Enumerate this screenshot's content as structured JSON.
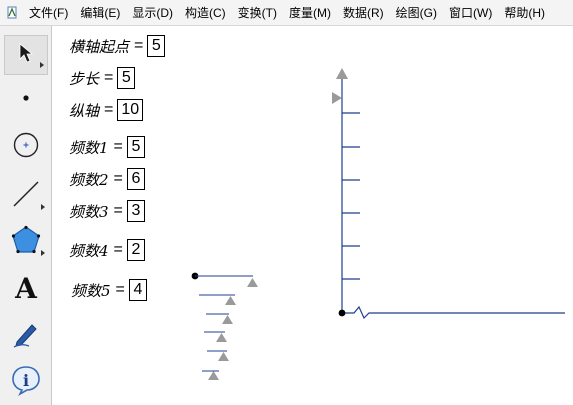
{
  "menubar": {
    "items": [
      "文件(F)",
      "编辑(E)",
      "显示(D)",
      "构造(C)",
      "变换(T)",
      "度量(M)",
      "数据(R)",
      "绘图(G)",
      "窗口(W)",
      "帮助(H)"
    ]
  },
  "toolbar": {
    "tools": [
      {
        "name": "arrow-select-tool",
        "icon": "arrow-icon"
      },
      {
        "name": "point-tool",
        "icon": "point-icon"
      },
      {
        "name": "compass-tool",
        "icon": "circle-icon"
      },
      {
        "name": "straightedge-tool",
        "icon": "line-icon"
      },
      {
        "name": "polygon-tool",
        "icon": "pentagon-icon"
      },
      {
        "name": "text-tool",
        "icon": "text-A-icon",
        "glyph": "A"
      },
      {
        "name": "marker-tool",
        "icon": "pen-icon"
      },
      {
        "name": "information-tool",
        "icon": "info-icon",
        "glyph": "i"
      }
    ]
  },
  "parameters": [
    {
      "label": "横轴起点",
      "value": "5"
    },
    {
      "label": "步长",
      "value": "5"
    },
    {
      "label": "纵轴",
      "value": "10"
    },
    {
      "label": "频数1",
      "value": "5"
    },
    {
      "label": "频数2",
      "value": "6"
    },
    {
      "label": "频数3",
      "value": "3"
    },
    {
      "label": "频数4",
      "value": "2"
    },
    {
      "label": "频数5",
      "value": "4"
    }
  ],
  "colors": {
    "axis": "#1f3f8f",
    "tick": "#1f3f8f",
    "handle": "#9a9a9a",
    "point": "#000000"
  }
}
